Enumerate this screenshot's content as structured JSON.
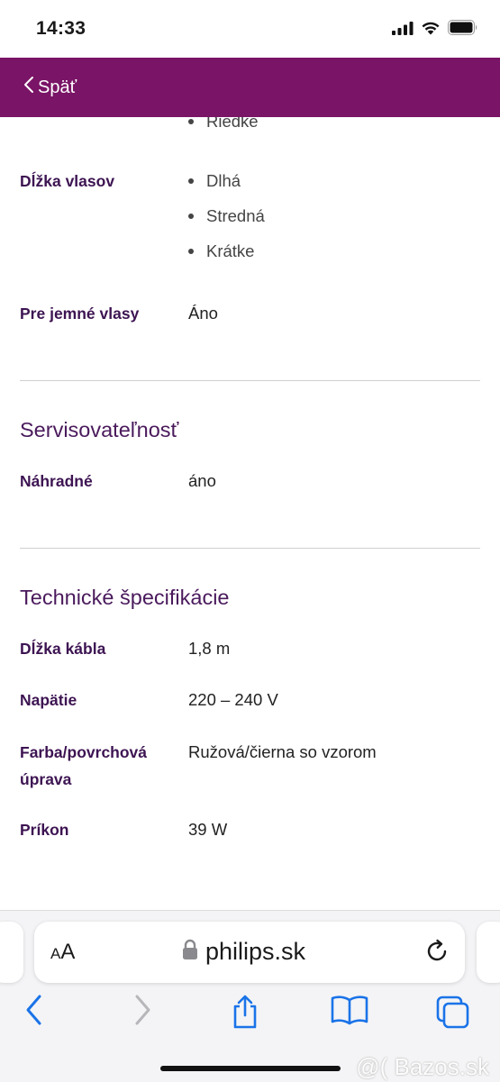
{
  "status_bar": {
    "time": "14:33"
  },
  "header": {
    "back_label": "Späť"
  },
  "content": {
    "partial_bullet": "Riedke",
    "hair_length": {
      "label": "Dĺžka vlasov",
      "items": [
        "Dlhá",
        "Stredná",
        "Krátke"
      ]
    },
    "fine_hair": {
      "label": "Pre jemné vlasy",
      "value": "Áno"
    },
    "serviceability": {
      "title": "Servisovateľnosť",
      "rows": [
        {
          "label": "Náhradné",
          "value": "áno"
        }
      ]
    },
    "technical": {
      "title": "Technické špecifikácie",
      "cable": {
        "label": "Dĺžka kábla",
        "value": "1,8  m"
      },
      "voltage": {
        "label": "Napätie",
        "value": "220 – 240  V"
      },
      "color": {
        "label_line1": "Farba/povrchová",
        "label_line2": "úprava",
        "value": "Ružová/čierna so vzorom"
      },
      "power": {
        "label": "Príkon",
        "value": "39  W"
      }
    }
  },
  "browser": {
    "aa_small": "A",
    "aa_large": "A",
    "url": "philips.sk"
  },
  "watermark": "@( Bazos.sk",
  "colors": {
    "header_bg": "#7a1466",
    "label": "#3d1452",
    "section_title": "#4a1a5c",
    "toolbar_icon": "#1a73e8"
  }
}
